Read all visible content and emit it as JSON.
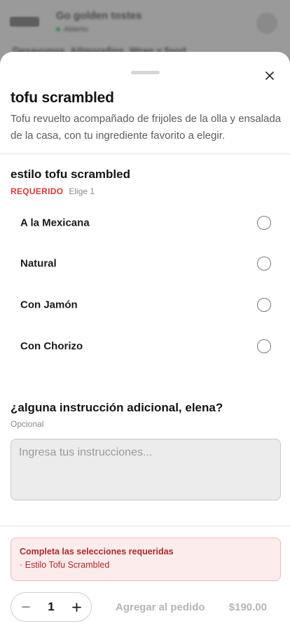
{
  "background": {
    "restaurant_name": "Go golden tostes",
    "status": "Abierto",
    "second_line": "Desayunos, Allmorefins, Wrap y food"
  },
  "item": {
    "title": "tofu scrambled",
    "description": "Tofu revuelto acompañado de frijoles de la olla y ensalada de la casa, con tu ingrediente favorito a elegir."
  },
  "option_group": {
    "title": "estilo tofu scrambled",
    "required_label": "REQUERIDO",
    "choose_label": "Elige 1",
    "options": [
      {
        "label": "A la Mexicana"
      },
      {
        "label": "Natural"
      },
      {
        "label": "Con Jamón"
      },
      {
        "label": "Con Chorizo"
      }
    ]
  },
  "instructions": {
    "title": "¿alguna instrucción adicional, elena?",
    "optional_label": "Opcional",
    "placeholder": "Ingresa tus instrucciones..."
  },
  "alert": {
    "title": "Completa las selecciones requeridas",
    "items": [
      "· Estilo Tofu Scrambled"
    ]
  },
  "footer": {
    "quantity": "1",
    "add_label": "Agregar al pedido",
    "price": "$190.00"
  },
  "icons": {
    "close": "close-icon",
    "minus": "minus-icon",
    "plus": "plus-icon"
  },
  "colors": {
    "required": "#d93a3a",
    "alert_bg": "#fdecec",
    "alert_text": "#b0282c"
  }
}
